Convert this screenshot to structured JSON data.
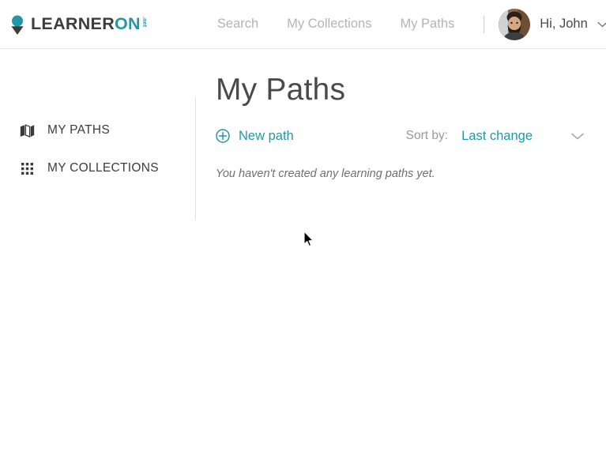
{
  "header": {
    "logo": {
      "name": "LearnerOn logo",
      "word_primary": "LEARNER",
      "word_accent": "ON",
      "tld": ".net"
    },
    "nav": [
      {
        "label": "Search",
        "name": "nav-search"
      },
      {
        "label": "My Collections",
        "name": "nav-my-collections"
      },
      {
        "label": "My Paths",
        "name": "nav-my-paths"
      }
    ],
    "user": {
      "greeting": "Hi, John",
      "avatar_alt": "John avatar",
      "caret": "chevron-down"
    }
  },
  "sidebar": {
    "items": [
      {
        "label": "MY PATHS",
        "icon": "map-icon"
      },
      {
        "label": "MY COLLECTIONS",
        "icon": "grid-icon"
      }
    ]
  },
  "main": {
    "title": "My Paths",
    "new_path_label": "New path",
    "sort_label": "Sort by:",
    "sort_value": "Last change",
    "empty_message": "You haven't created any learning paths yet."
  },
  "colors": {
    "accent": "#2397a6",
    "text_dark": "#3d3d3d",
    "text_muted": "#b4b4b4",
    "border": "#e9e9e9"
  }
}
